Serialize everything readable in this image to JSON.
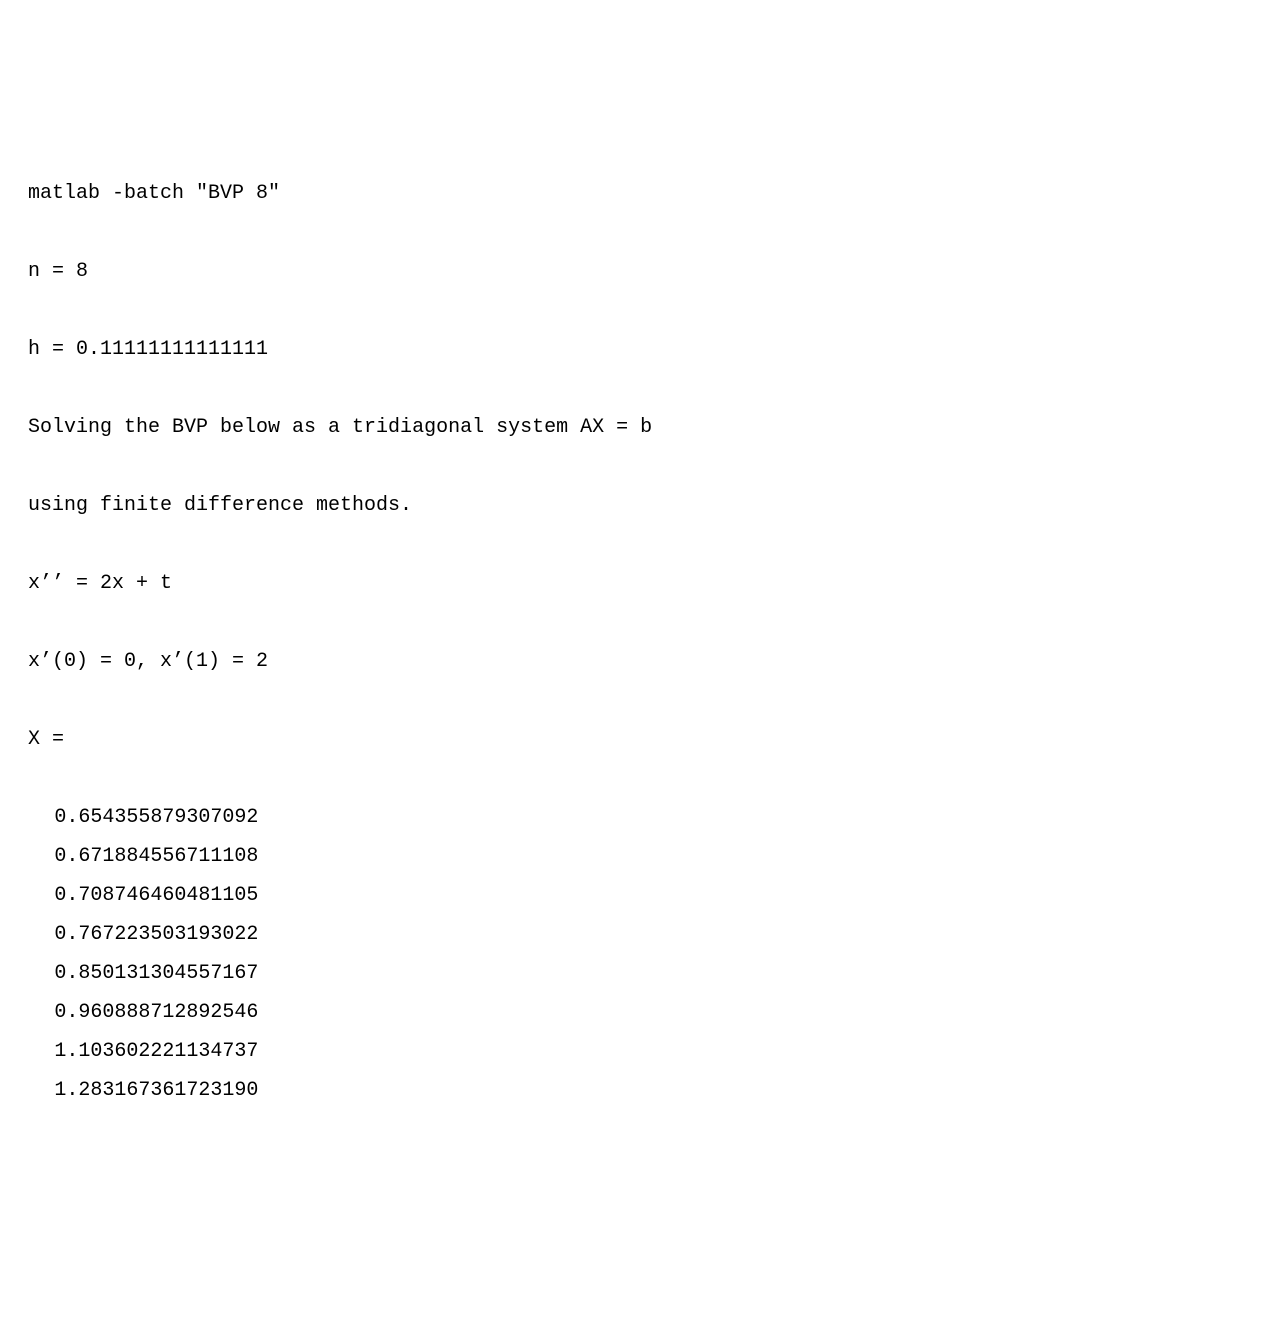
{
  "terminal": {
    "command": "matlab -batch \"BVP 8\"",
    "n_line": "n = 8",
    "h_line": "h = 0.11111111111111",
    "desc1": "Solving the BVP below as a tridiagonal system AX = b",
    "desc2": "using finite difference methods.",
    "eq1": "x’’ = 2x + t",
    "eq2": "x’(0) = 0, x’(1) = 2",
    "x_header": "X =",
    "values": [
      "0.654355879307092",
      "0.671884556711108",
      "0.708746460481105",
      "0.767223503193022",
      "0.850131304557167",
      "0.960888712892546",
      "1.103602221134737",
      "1.283167361723190"
    ]
  }
}
